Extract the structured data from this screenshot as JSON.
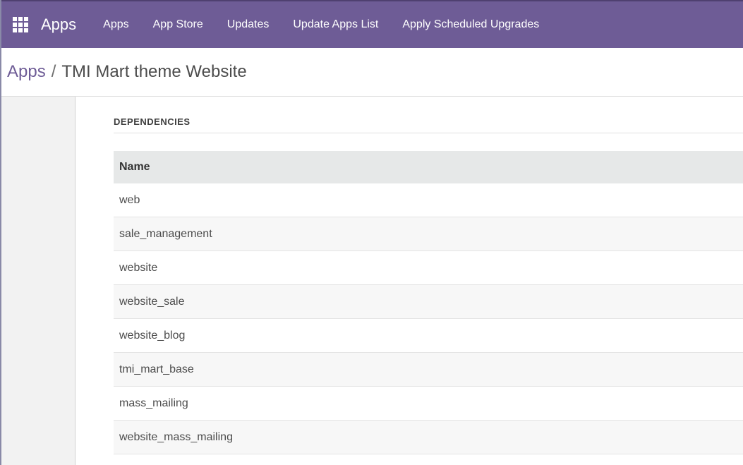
{
  "navbar": {
    "apps_menu_icon": "apps-grid-icon",
    "brand": "Apps",
    "menu": [
      "Apps",
      "App Store",
      "Updates",
      "Update Apps List",
      "Apply Scheduled Upgrades"
    ]
  },
  "breadcrumb": {
    "parent": "Apps",
    "separator": "/",
    "current": "TMI Mart theme Website"
  },
  "section": {
    "title": "DEPENDENCIES"
  },
  "table": {
    "header": "Name",
    "rows": [
      "web",
      "sale_management",
      "website",
      "website_sale",
      "website_blog",
      "tmi_mart_base",
      "mass_mailing",
      "website_mass_mailing"
    ]
  },
  "colors": {
    "navbar": "#6e5c96",
    "link": "#6e5c96",
    "table_header": "#e6e8e8"
  }
}
